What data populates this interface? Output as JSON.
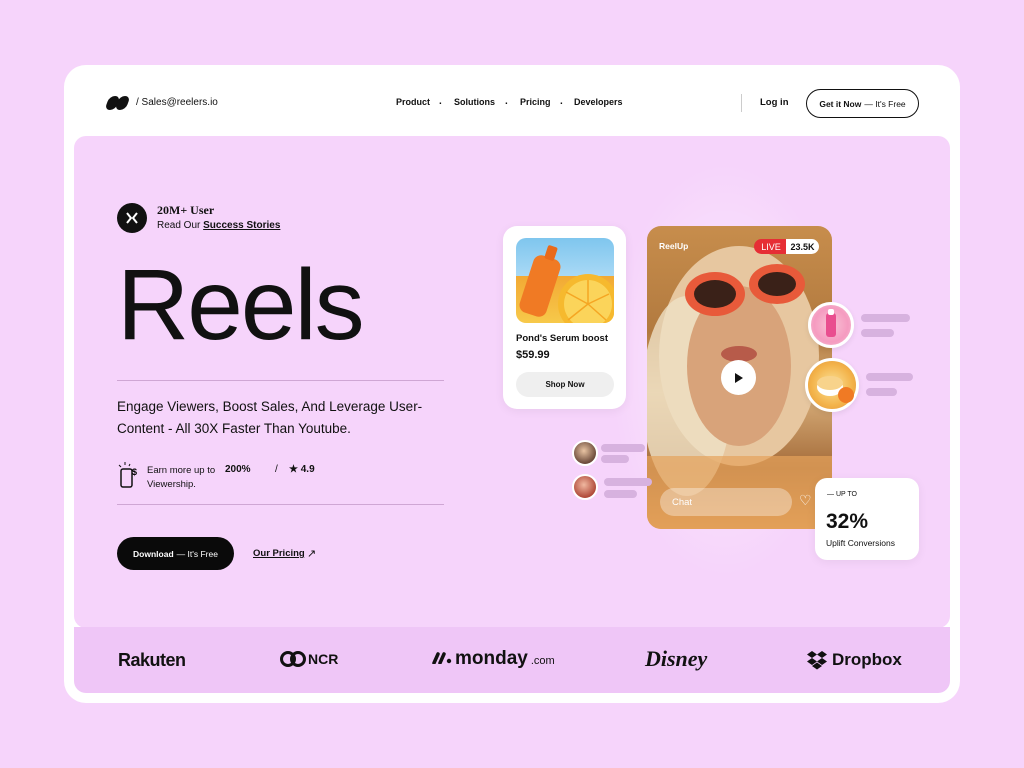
{
  "nav": {
    "email": "/ Sales@reelers.io",
    "links": [
      "Product",
      "Solutions",
      "Pricing",
      "Developers"
    ],
    "login": "Log in",
    "cta_bold": "Get it Now",
    "cta_rest": "— It's Free"
  },
  "hero": {
    "users_count": "20M+ User",
    "users_sub_prefix": "Read Our",
    "users_sub_link": "Success Stories",
    "title": "Reels",
    "tagline": "Engage Viewers, Boost Sales, And Leverage User-Content - All 30X Faster Than Youtube.",
    "earn_line1": "Earn more up to",
    "earn_pct": "200%",
    "earn_line2": "Viewership.",
    "slash": "/",
    "rating": "★ 4.9",
    "download_bold": "Download",
    "download_rest": "— It's Free",
    "pricing_link": "Our Pricing"
  },
  "product": {
    "name": "Pond's Serum boost",
    "price": "$59.99",
    "shop_label": "Shop Now"
  },
  "video": {
    "brand": "ReelUp",
    "live_label": "LIVE",
    "viewers": "23.5K",
    "chat_placeholder": "Chat"
  },
  "stat": {
    "prefix": "— UP TO",
    "value": "32%",
    "label": "Uplift Conversions"
  },
  "logos": [
    "Rakuten",
    "NCR",
    "monday",
    ".com",
    "Disney",
    "Dropbox"
  ],
  "colors": {
    "background": "#f6d4fb",
    "band": "#efc6f7",
    "live_red": "#e62e35",
    "accent_black": "#0a0a0a"
  }
}
